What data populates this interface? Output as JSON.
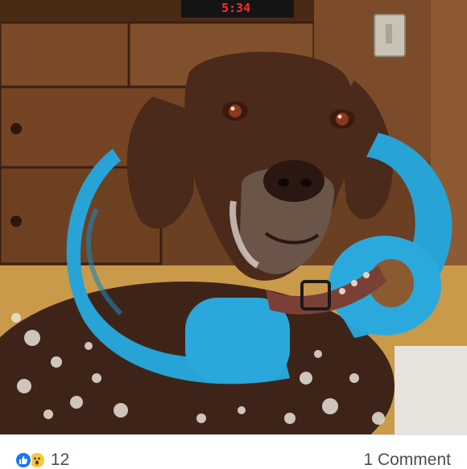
{
  "photo": {
    "clock_readout": "5:34",
    "description_icon": "dog-photo"
  },
  "reactions": {
    "icons": [
      "like-icon",
      "wow-icon"
    ],
    "count": "12"
  },
  "comments": {
    "label": "1 Comment"
  },
  "colors": {
    "like": "#1877f2",
    "wow": "#f7c63d",
    "pool_noodle": "#27a3d6",
    "text": "#4b4f56"
  }
}
